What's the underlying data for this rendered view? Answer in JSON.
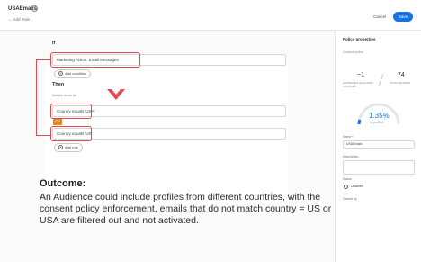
{
  "header": {
    "title": "USAEmails",
    "breadcrumb": "Add Rule",
    "cancel_label": "Cancel",
    "save_label": "Save"
  },
  "rule": {
    "if_label": "If",
    "condition1": "Marketing Action: Email Messages",
    "add_condition_label": "Add condition",
    "then_label": "Then",
    "then_sub": "Values must be",
    "condition2": "Country equals 'USA'",
    "or_label": "OR",
    "condition3": "Country equals 'US'",
    "add_label": "Add rule"
  },
  "outcome": {
    "title": "Outcome:",
    "body": "An Audience could include profiles from different countries, with the consent policy enforcement, emails that do not match country = US or USA are filtered out and not activated."
  },
  "panel": {
    "title": "Policy properties",
    "policy_type": "Consent policy",
    "stat1_value": "~1",
    "stat1_label": "ESTIMATED QUALIFIED PROFILES",
    "stat2_value": "74",
    "stat2_label": "TOTAL ENTRIES",
    "percent": "1.35%",
    "percent_label": "of profiles",
    "name_label": "Name *",
    "name_value": "USAEmails",
    "desc_label": "Description",
    "status_label": "Status",
    "status_value": "Disabled",
    "owner_label": "Owned by"
  },
  "colors": {
    "accent": "#1473e6",
    "highlight": "#e34850",
    "or_chip": "#e68619"
  }
}
